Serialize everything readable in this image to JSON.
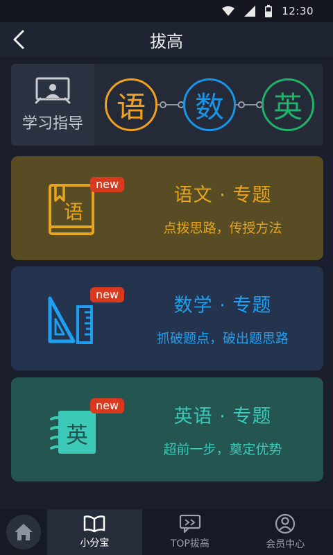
{
  "status": {
    "time": "12:30"
  },
  "header": {
    "title": "拔高"
  },
  "guide": {
    "label": "学习指导",
    "subjects": [
      "语",
      "数",
      "英"
    ]
  },
  "cards": [
    {
      "icon_char": "语",
      "badge": "new",
      "title": "语文 · 专题",
      "subtitle": "点拨思路，传授方法",
      "color": "#e6a520"
    },
    {
      "icon_char": "",
      "badge": "new",
      "title": "数学 · 专题",
      "subtitle": "抓破题点，破出题思路",
      "color": "#1e9ff0"
    },
    {
      "icon_char": "英",
      "badge": "new",
      "title": "英语 · 专题",
      "subtitle": "超前一步，奠定优势",
      "color": "#3cc9b8"
    }
  ],
  "nav": {
    "items": [
      {
        "label": "小分宝",
        "icon": "book-icon",
        "active": true
      },
      {
        "label": "TOP拔高",
        "icon": "chat-icon",
        "active": false
      },
      {
        "label": "会员中心",
        "icon": "user-icon",
        "active": false
      }
    ]
  },
  "icons": {
    "status": [
      "wifi-icon",
      "signal-icon",
      "battery-icon"
    ],
    "back": "back-arrow-icon",
    "home": "home-icon",
    "guide": "presentation-icon"
  }
}
